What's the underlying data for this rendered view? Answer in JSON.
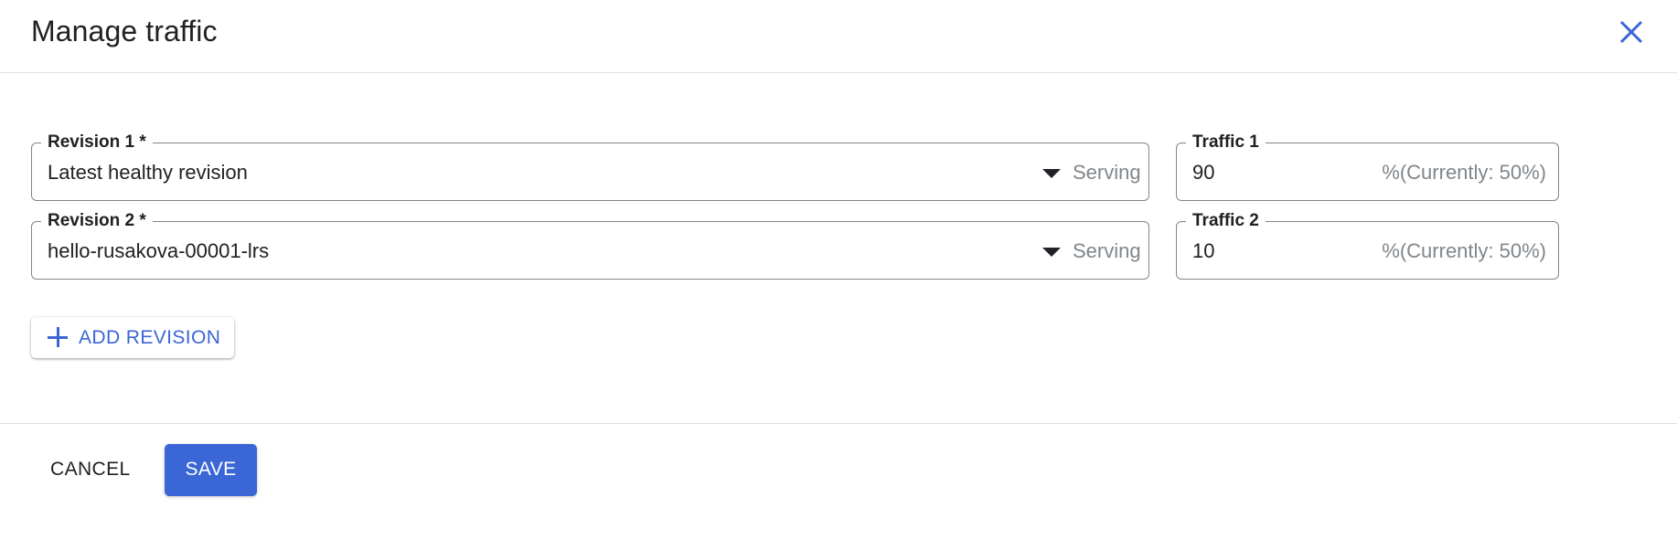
{
  "dialog": {
    "title": "Manage traffic",
    "close_icon": "close-icon"
  },
  "revisions": [
    {
      "label": "Revision 1 *",
      "value": "Latest healthy revision",
      "status": "Serving",
      "icon": "dropdown-arrow-icon"
    },
    {
      "label": "Revision 2 *",
      "value": "hello-rusakova-00001-lrs",
      "status": "Serving",
      "icon": "dropdown-arrow-icon"
    }
  ],
  "traffic": [
    {
      "label": "Traffic 1",
      "value": "90",
      "suffix": "%(Currently: 50%)"
    },
    {
      "label": "Traffic 2",
      "value": "10",
      "suffix": "%(Currently: 50%)"
    }
  ],
  "add_revision": {
    "label": "ADD REVISION",
    "icon": "plus-icon"
  },
  "footer": {
    "cancel_label": "CANCEL",
    "save_label": "SAVE"
  },
  "colors": {
    "accent": "#3b66d6",
    "border": "#80868b",
    "muted_text": "#80868b"
  }
}
